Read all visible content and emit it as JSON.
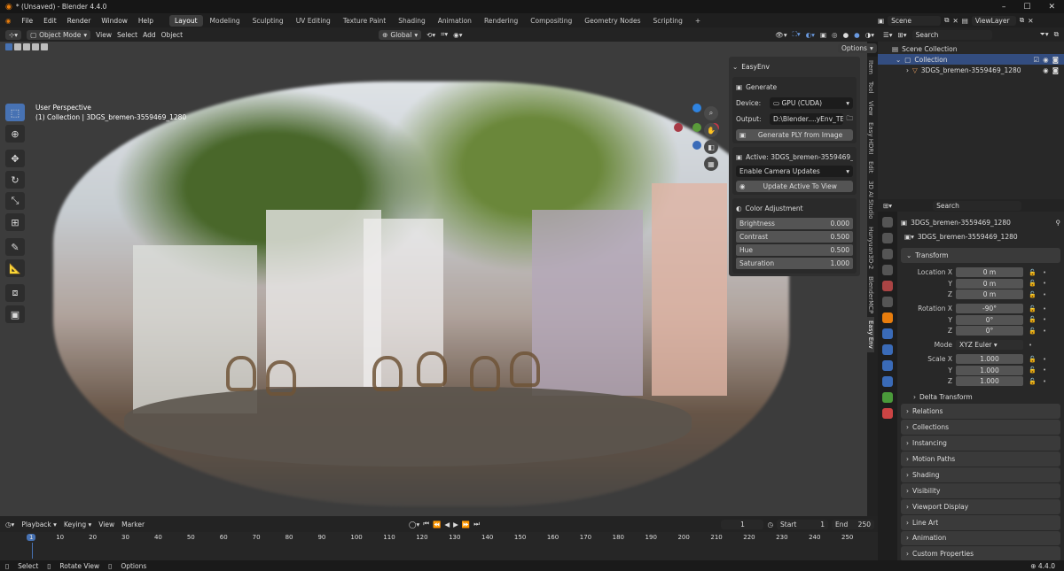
{
  "window": {
    "title": "* (Unsaved) - Blender 4.4.0"
  },
  "menu": [
    "File",
    "Edit",
    "Render",
    "Window",
    "Help"
  ],
  "workspaces": [
    "Layout",
    "Modeling",
    "Sculpting",
    "UV Editing",
    "Texture Paint",
    "Shading",
    "Animation",
    "Rendering",
    "Compositing",
    "Geometry Nodes",
    "Scripting"
  ],
  "active_workspace": "Layout",
  "scene": {
    "name": "Scene",
    "view_layer": "ViewLayer"
  },
  "viewport_header": {
    "mode": "Object Mode",
    "menus": [
      "View",
      "Select",
      "Add",
      "Object"
    ],
    "orientation": "Global",
    "options": "Options"
  },
  "viewport_overlay": {
    "perspective": "User Perspective",
    "context": "(1) Collection | 3DGS_bremen-3559469_1280"
  },
  "easyenv": {
    "title": "EasyEnv",
    "generate_label": "Generate",
    "device_label": "Device:",
    "device_value": "GPU (CUDA)",
    "output_label": "Output:",
    "output_value": "D:\\Blender....yEnv_TEST\\",
    "generate_button": "Generate PLY from Image",
    "active_label": "Active: 3DGS_bremen-3559469_...",
    "camera_updates": "Enable Camera Updates",
    "update_button": "Update Active To View",
    "color_title": "Color Adjustment",
    "sliders": [
      {
        "label": "Brightness",
        "value": "0.000"
      },
      {
        "label": "Contrast",
        "value": "0.500"
      },
      {
        "label": "Hue",
        "value": "0.500"
      },
      {
        "label": "Saturation",
        "value": "1.000"
      }
    ]
  },
  "sidebar_tabs": [
    "Item",
    "Tool",
    "View",
    "Easy HDRI",
    "Edit",
    "3D AI Studio",
    "Hunyuan3D-2",
    "BlenderMCP",
    "Easy Env"
  ],
  "outliner": {
    "search_placeholder": "Search",
    "root": "Scene Collection",
    "collection": "Collection",
    "object": "3DGS_bremen-3559469_1280"
  },
  "properties": {
    "search_placeholder": "Search",
    "object_name": "3DGS_bremen-3559469_1280",
    "data_name": "3DGS_bremen-3559469_1280",
    "transform_title": "Transform",
    "rows": [
      {
        "label": "Location X",
        "value": "0 m"
      },
      {
        "label": "Y",
        "value": "0 m"
      },
      {
        "label": "Z",
        "value": "0 m"
      },
      {
        "label": "Rotation X",
        "value": "-90°"
      },
      {
        "label": "Y",
        "value": "0°"
      },
      {
        "label": "Z",
        "value": "0°"
      },
      {
        "label": "Mode",
        "value": "XYZ Euler"
      },
      {
        "label": "Scale X",
        "value": "1.000"
      },
      {
        "label": "Y",
        "value": "1.000"
      },
      {
        "label": "Z",
        "value": "1.000"
      }
    ],
    "delta": "Delta Transform",
    "sections": [
      "Relations",
      "Collections",
      "Instancing",
      "Motion Paths",
      "Shading",
      "Visibility",
      "Viewport Display",
      "Line Art",
      "Animation",
      "Custom Properties"
    ]
  },
  "timeline": {
    "menus": [
      "Playback",
      "Keying",
      "View",
      "Marker"
    ],
    "current_frame": "1",
    "start_label": "Start",
    "start": "1",
    "end_label": "End",
    "end": "250",
    "ticks": [
      "1",
      "10",
      "20",
      "30",
      "40",
      "50",
      "60",
      "70",
      "80",
      "90",
      "100",
      "110",
      "120",
      "130",
      "140",
      "150",
      "160",
      "170",
      "180",
      "190",
      "200",
      "210",
      "220",
      "230",
      "240",
      "250"
    ]
  },
  "statusbar": {
    "items": [
      "Select",
      "Rotate View",
      "Options"
    ],
    "version": "4.4.0"
  }
}
